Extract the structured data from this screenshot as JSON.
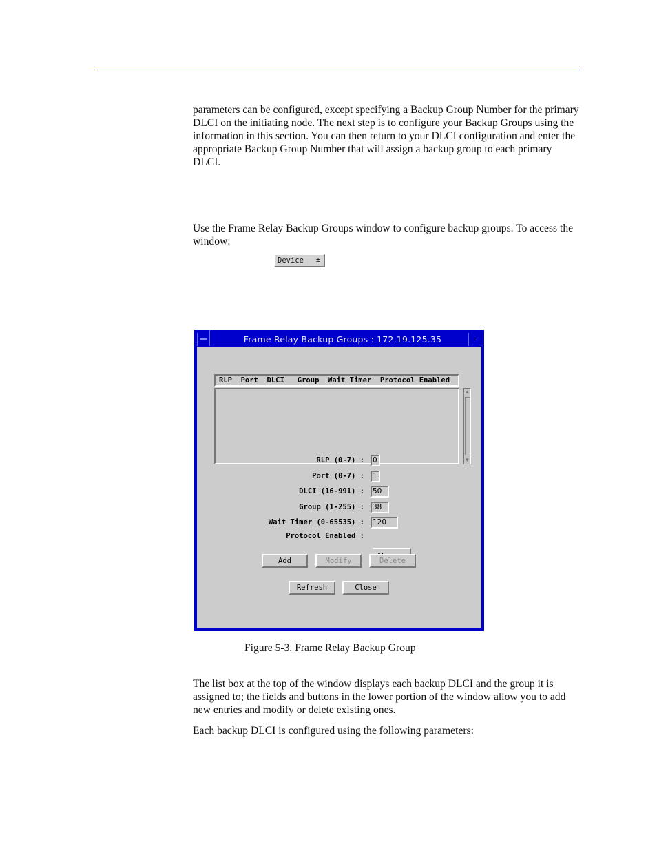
{
  "document": {
    "paragraph_1": "parameters can be configured, except specifying a Backup Group Number for the primary DLCI on the initiating node. The next step is to configure your Backup Groups using the information in this section. You can then return to your DLCI configuration and enter the appropriate Backup Group Number that will assign a backup group to each primary DLCI.",
    "paragraph_2": "Use the Frame Relay Backup Groups window to configure backup groups. To access the window:",
    "device_select": {
      "label": "Device",
      "arrow": "±"
    },
    "figure_caption": "Figure 5-3.  Frame Relay Backup Group",
    "paragraph_3": "The list box at the top of the window displays each backup DLCI and the group it is assigned to; the fields and buttons in the lower portion of the window allow you to add new entries and modify or delete existing ones.",
    "paragraph_4": "Each backup DLCI is configured using the following parameters:"
  },
  "window": {
    "title": "Frame Relay Backup Groups : 172.19.125.35",
    "list_header": "RLP  Port  DLCI   Group  Wait Timer  Protocol Enabled",
    "list_columns": [
      "RLP",
      "Port",
      "DLCI",
      "Group",
      "Wait Timer",
      "Protocol Enabled"
    ],
    "list_rows": [],
    "scroll_up": "▲",
    "scroll_down": "▼",
    "fields": [
      {
        "label": "RLP (0-7) :",
        "value": "0"
      },
      {
        "label": "Port (0-7) :",
        "value": "1"
      },
      {
        "label": "DLCI (16-991) :",
        "value": "50"
      },
      {
        "label": "Group (1-255) :",
        "value": "38"
      },
      {
        "label": "Wait Timer (0-65535) :",
        "value": "120"
      }
    ],
    "protocol_enabled": {
      "label": "Protocol Enabled :",
      "value": "No"
    },
    "buttons": {
      "add": "Add",
      "modify": "Modify",
      "delete": "Delete",
      "refresh": "Refresh",
      "close": "Close"
    },
    "colors": {
      "frame": "#0000cc",
      "background": "#cccccc"
    }
  }
}
